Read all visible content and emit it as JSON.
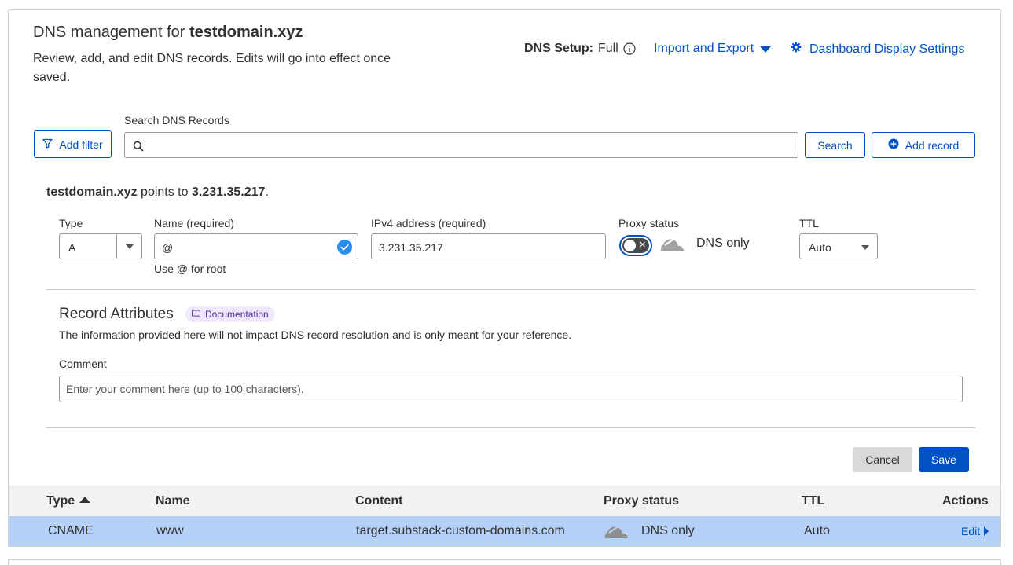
{
  "header": {
    "title_prefix": "DNS management for ",
    "domain": "testdomain.xyz",
    "description": "Review, add, and edit DNS records. Edits will go into effect once saved.",
    "dns_setup_label": "DNS Setup:",
    "dns_setup_value": "Full",
    "import_export_label": "Import and Export",
    "dashboard_settings_label": "Dashboard Display Settings"
  },
  "toolbar": {
    "add_filter_label": "Add filter",
    "search_label": "Search DNS Records",
    "search_value": "",
    "search_button_label": "Search",
    "add_record_label": "Add record"
  },
  "record_form": {
    "points_domain": "testdomain.xyz",
    "points_middle": " points to ",
    "points_ip": "3.231.35.217",
    "points_end": ".",
    "type_label": "Type",
    "type_value": "A",
    "name_label": "Name (required)",
    "name_value": "@",
    "name_hint": "Use @ for root",
    "ipv4_label": "IPv4 address (required)",
    "ipv4_value": "3.231.35.217",
    "proxy_label": "Proxy status",
    "proxy_enabled": false,
    "proxy_value": "DNS only",
    "ttl_label": "TTL",
    "ttl_value": "Auto"
  },
  "attributes": {
    "title": "Record Attributes",
    "doc_badge": "Documentation",
    "description": "The information provided here will not impact DNS record resolution and is only meant for your reference.",
    "comment_label": "Comment",
    "comment_placeholder": "Enter your comment here (up to 100 characters).",
    "comment_value": ""
  },
  "actions": {
    "cancel_label": "Cancel",
    "save_label": "Save"
  },
  "table": {
    "columns": [
      "Type",
      "Name",
      "Content",
      "Proxy status",
      "TTL",
      "Actions"
    ],
    "rows": [
      {
        "type": "CNAME",
        "name": "www",
        "content": "target.substack-custom-domains.com",
        "proxy": "DNS only",
        "ttl": "Auto",
        "action": "Edit"
      }
    ]
  },
  "colors": {
    "link": "#0051c3",
    "selected_row": "#b5d1f7",
    "header_bg": "#f2f2f2",
    "badge_bg": "#eee8fb"
  }
}
